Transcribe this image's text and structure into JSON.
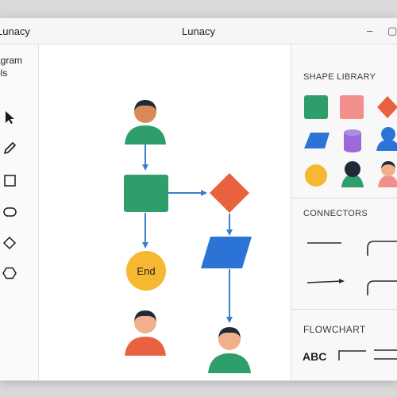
{
  "window": {
    "title": "Lunacy",
    "app_name": "Lunacy"
  },
  "left_panel": {
    "title_line1": "agram",
    "title_line2": "ols"
  },
  "canvas": {
    "end_label": "End"
  },
  "right_panel": {
    "shape_library_title": "SHAPE LIBRARY",
    "connectors_title": "CONNECTORS",
    "flowchart_title": "FLOWCHART",
    "flowchart_text_label": "ABC"
  },
  "colors": {
    "green": "#2e9e6a",
    "orange": "#e8623f",
    "blue": "#2b74d6",
    "yellow": "#f6b830",
    "pink": "#f28e8c",
    "purple": "#9a6ad8",
    "arrow_blue": "#3a7fcf"
  }
}
